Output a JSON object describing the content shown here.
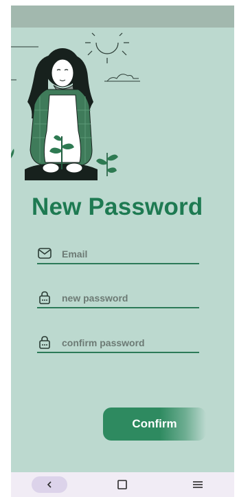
{
  "screen": {
    "title": "New Password"
  },
  "form": {
    "email": {
      "placeholder": "Email",
      "value": "",
      "icon": "envelope-icon"
    },
    "new_password": {
      "placeholder": "new password",
      "value": "",
      "icon": "lock-icon"
    },
    "confirm_password": {
      "placeholder": "confirm password",
      "value": "",
      "icon": "lock-icon"
    }
  },
  "actions": {
    "confirm_label": "Confirm"
  },
  "nav": {
    "back_icon": "chevron-left-icon",
    "home_icon": "square-icon",
    "menu_icon": "hamburger-icon"
  },
  "colors": {
    "background": "#bcd9cf",
    "status_bar": "#a2b8ae",
    "accent": "#1e7a52",
    "button": "#2e8a60",
    "nav_bar": "#f1ecf5"
  }
}
